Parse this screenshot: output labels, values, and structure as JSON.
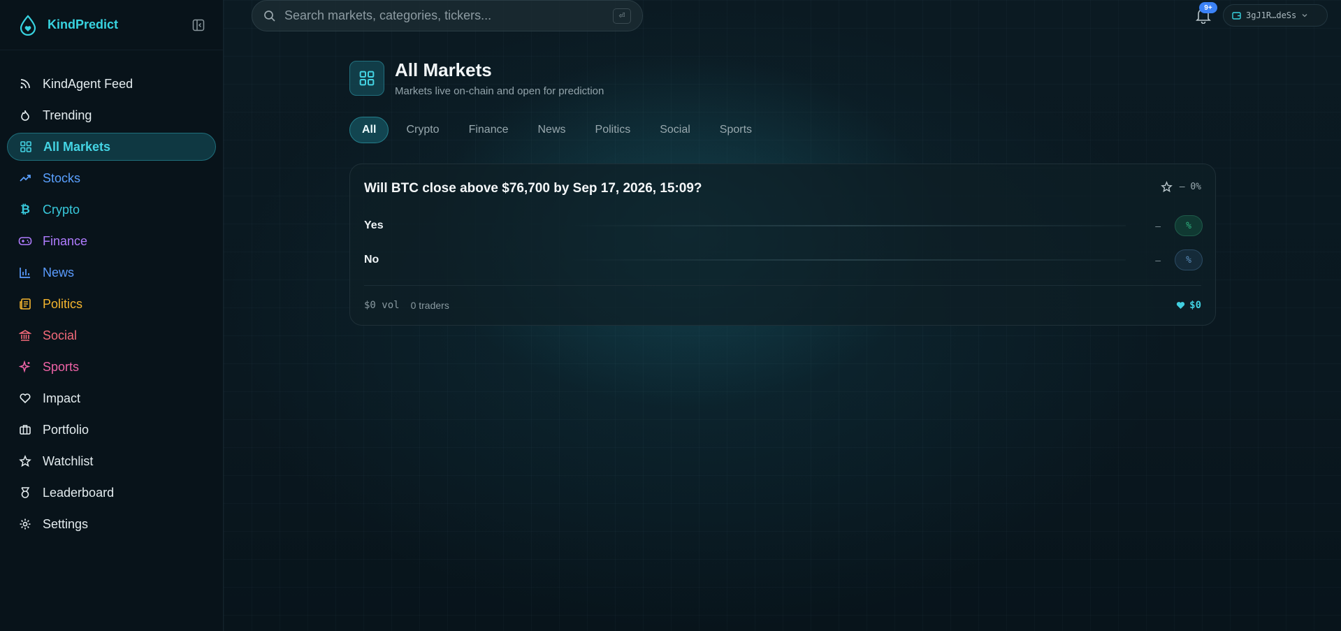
{
  "app": {
    "name": "KindPredict"
  },
  "search": {
    "placeholder": "Search markets, categories, tickers...",
    "shortcut": "⏎"
  },
  "notifications": {
    "badge": "9+"
  },
  "wallet": {
    "address": "3gJ1R…deSs"
  },
  "sidebar": {
    "items": [
      {
        "label": "KindAgent Feed",
        "icon": "rss-icon",
        "color": "#e4ecef"
      },
      {
        "label": "Trending",
        "icon": "flame-icon",
        "color": "#e4ecef"
      },
      {
        "label": "All Markets",
        "icon": "grid-icon",
        "color": "#44d4e4",
        "active": true
      },
      {
        "label": "Stocks",
        "icon": "trending-up-icon",
        "color": "#5aa0ff"
      },
      {
        "label": "Crypto",
        "icon": "bitcoin-icon",
        "color": "#38c9dc"
      },
      {
        "label": "Finance",
        "icon": "gamepad-icon",
        "color": "#b07cff"
      },
      {
        "label": "News",
        "icon": "bar-chart-icon",
        "color": "#5b9cff"
      },
      {
        "label": "Politics",
        "icon": "newspaper-icon",
        "color": "#f5b52e"
      },
      {
        "label": "Social",
        "icon": "landmark-icon",
        "color": "#f56a7a"
      },
      {
        "label": "Sports",
        "icon": "sparkles-icon",
        "color": "#ee63a6"
      },
      {
        "label": "Impact",
        "icon": "heart-icon",
        "color": "#e4ecef"
      },
      {
        "label": "Portfolio",
        "icon": "briefcase-icon",
        "color": "#e4ecef"
      },
      {
        "label": "Watchlist",
        "icon": "star-icon",
        "color": "#e4ecef"
      },
      {
        "label": "Leaderboard",
        "icon": "medal-icon",
        "color": "#e4ecef"
      },
      {
        "label": "Settings",
        "icon": "gear-icon",
        "color": "#e4ecef"
      }
    ]
  },
  "header": {
    "title": "All Markets",
    "subtitle": "Markets live on-chain and open for prediction"
  },
  "tabs": [
    "All",
    "Crypto",
    "Finance",
    "News",
    "Politics",
    "Social",
    "Sports"
  ],
  "market": {
    "question": "Will BTC close above $76,700 by Sep 17, 2026, 15:09?",
    "change": "— 0%",
    "outcomes": [
      {
        "label": "Yes",
        "value": "–",
        "percent": "%"
      },
      {
        "label": "No",
        "value": "–",
        "percent": "%"
      }
    ],
    "volume": "$0 vol",
    "traders": "0 traders",
    "impact": "$0"
  },
  "colors": {
    "accent": "#38d3e0",
    "yes": "#2fb37f",
    "no": "#5b8fbf"
  }
}
